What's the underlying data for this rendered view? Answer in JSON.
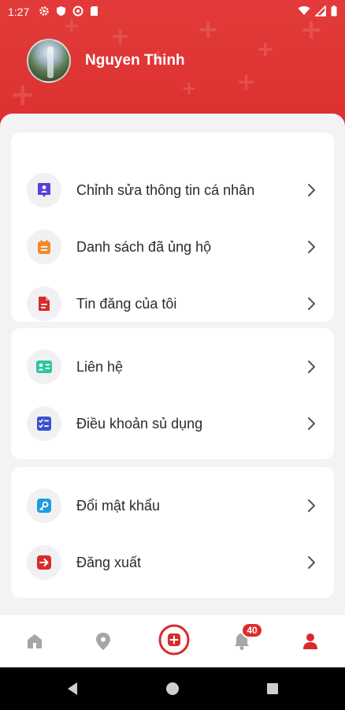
{
  "status_bar": {
    "time": "1:27"
  },
  "profile": {
    "name": "Nguyen Thinh"
  },
  "menu_groups": [
    {
      "items": [
        {
          "label": "Chỉnh sửa thông tin cá nhân",
          "icon": "user-id-icon",
          "color": "#5b3fd6"
        },
        {
          "label": "Danh sách đã ủng hộ",
          "icon": "calendar-list-icon",
          "color": "#f28a2a"
        },
        {
          "label": "Tin đăng của tôi",
          "icon": "document-icon",
          "color": "#d82b2b"
        }
      ]
    },
    {
      "items": [
        {
          "label": "Liên hệ",
          "icon": "contact-card-icon",
          "color": "#2ec6a0"
        },
        {
          "label": "Điều khoản sủ dụng",
          "icon": "checklist-icon",
          "color": "#3a52d1"
        }
      ]
    },
    {
      "items": [
        {
          "label": "Đổi mật khẩu",
          "icon": "key-icon",
          "color": "#1e9be0"
        },
        {
          "label": "Đăng xuất",
          "icon": "logout-icon",
          "color": "#d82b2b"
        }
      ]
    }
  ],
  "bottom_nav": {
    "items": [
      "home-icon",
      "location-icon",
      "add-post-icon",
      "notification-bell-icon",
      "profile-icon"
    ],
    "notification_count": "40",
    "active": "profile-icon",
    "active_color": "#d82b2b",
    "inactive_color": "#a6a6a6"
  },
  "colors": {
    "header_red": "#e23a3a",
    "background": "#f3f3f5"
  }
}
